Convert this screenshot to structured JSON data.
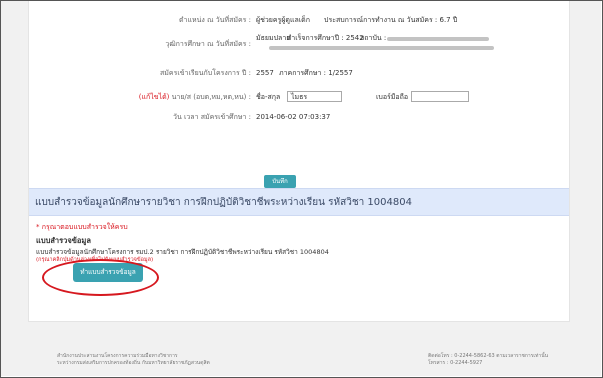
{
  "form": {
    "position_label": "ตำแหน่ง ณ วันที่สมัคร :",
    "position_value": "ผู้ช่วยครูผู้ดูแลเด็ก",
    "experience_label": "ประสบการณ์การทำงาน ณ วันสมัคร : 6.7 ปี",
    "education_label": "วุฒิการศึกษา ณ วันที่สมัคร :",
    "education_level": "มัธยมปลาย",
    "graduation_label": "สำเร็จการศึกษาปี : 2542",
    "institution_label": "สถาบัน :",
    "join_label": "สมัครเข้าเรียนกับโครงการ ปี :",
    "join_year": "2557",
    "semester_label": "ภาคการศึกษา : 1/2557",
    "edit_label": "(แก้ไขได้)",
    "title_label": "นาย/ส (อบต,หม,หต,หน) :",
    "name_label": "ชื่อ-สกุล",
    "name_value": "ไมธร",
    "mobile_label": "เบอร์มือถือ :",
    "date_label": "วัน เวลา สมัครเข้าศึกษา :",
    "date_value": "2014-06-02 07:03:37",
    "save_button": "บันทึก"
  },
  "survey": {
    "title": "แบบสำรวจข้อมูลนักศึกษารายวิชา การฝึกปฏิบัติวิชาชีพระหว่างเรียน รหัสวิชา 1004804",
    "warning": "* กรุณาตอบแบบสำรวจให้ครบ",
    "section_title": "แบบสำรวจข้อมูล",
    "description": "แบบสำรวจข้อมูลนักศึกษาโครงการ รมป.2 รายวิชา การฝึกปฏิบัติวิชาชีพระหว่างเรียน รหัสวิชา 1004804",
    "instruction": "(กรุณาคลิกปุ่มด้านล่างเพื่อไปยังแบบสำรวจข้อมูล)",
    "start_button": "ทำแบบสำรวจข้อมูล"
  },
  "footer": {
    "left_line1": "สำนักงานประสานงานโครงการความร่วมมือทางวิชาการ",
    "left_line2": "ระหว่างกรมส่งเสริมการปกครองท้องถิ่น กับมหาวิทยาลัยราชภัฏสวนดุสิต",
    "right_line1": "ติดต่อโทร : 0-2244-5862-63 ตามเวลาราชการเท่านั้น",
    "right_line2": "โทรสาร : 0-2244-5927"
  }
}
